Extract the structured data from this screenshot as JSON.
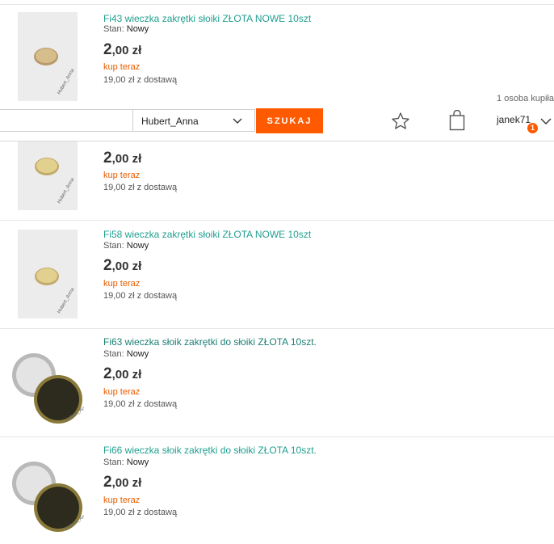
{
  "items": [
    {
      "title": "Fi43 wieczka zakrętki słoiki ZŁOTA NOWE 10szt",
      "state_label": "Stan:",
      "state_value": "Nowy",
      "price_int": "2",
      "price_dec": ",00 zł",
      "buy_label": "kup teraz",
      "shipping": "19,00 zł z dostawą",
      "watermark": "Hubert_Anna"
    },
    {
      "title": "",
      "state_label": "",
      "state_value": "",
      "price_int": "2",
      "price_dec": ",00 zł",
      "buy_label": "kup teraz",
      "shipping": "19,00 zł z dostawą",
      "watermark": "Hubert_Anna"
    },
    {
      "title": "Fi58 wieczka zakrętki słoiki ZŁOTA NOWE 10szt",
      "state_label": "Stan:",
      "state_value": "Nowy",
      "price_int": "2",
      "price_dec": ",00 zł",
      "buy_label": "kup teraz",
      "shipping": "19,00 zł z dostawą",
      "watermark": "Hubert_Anna"
    },
    {
      "title": "Fi63 wieczka słoik zakrętki do słoiki ZŁOTA 10szt.",
      "state_label": "Stan:",
      "state_value": "Nowy",
      "price_int": "2",
      "price_dec": ",00 zł",
      "buy_label": "kup teraz",
      "shipping": "19,00 zł z dostawą",
      "watermark": "Hubert_Anna"
    },
    {
      "title": "Fi66 wieczka słoik zakrętki do słoiki ZŁOTA 10szt.",
      "state_label": "Stan:",
      "state_value": "Nowy",
      "price_int": "2",
      "price_dec": ",00 zł",
      "buy_label": "kup teraz",
      "shipping": "19,00 zł z dostawą",
      "watermark": "Hubert_Anna"
    }
  ],
  "buyers_text": "1 osoba kupiła",
  "header": {
    "search_value": "",
    "seller_value": "Hubert_Anna",
    "search_button": "SZUKAJ",
    "username": "janek71",
    "notification_count": "1"
  },
  "colors": {
    "accent": "#ff5a00",
    "link": "#1f9f8f",
    "buy": "#e65c00"
  }
}
